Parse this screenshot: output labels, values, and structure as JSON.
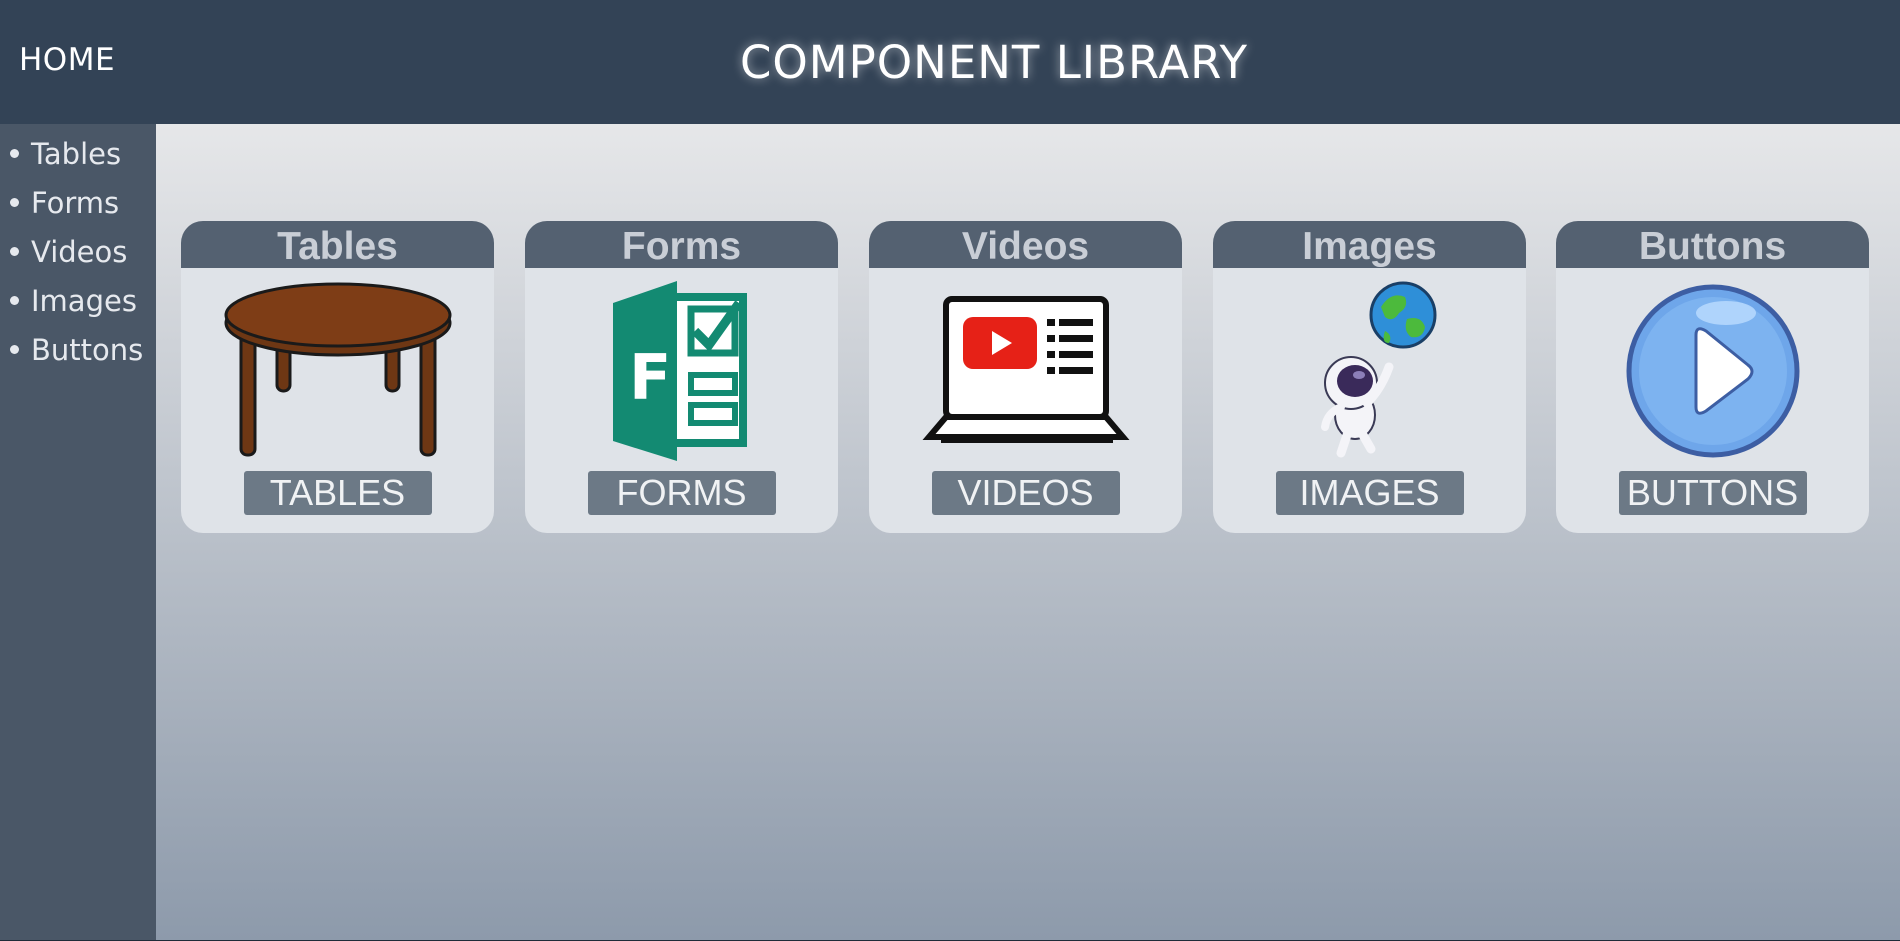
{
  "header": {
    "home_label": "HOME",
    "title": "COMPONENT LIBRARY"
  },
  "sidebar": {
    "items": [
      {
        "label": "Tables"
      },
      {
        "label": "Forms"
      },
      {
        "label": "Videos"
      },
      {
        "label": "Images"
      },
      {
        "label": "Buttons"
      }
    ]
  },
  "cards": [
    {
      "title": "Tables",
      "button_label": "TABLES",
      "icon": "table-icon"
    },
    {
      "title": "Forms",
      "button_label": "FORMS",
      "icon": "forms-icon"
    },
    {
      "title": "Videos",
      "button_label": "VIDEOS",
      "icon": "laptop-video-icon"
    },
    {
      "title": "Images",
      "button_label": "IMAGES",
      "icon": "astronaut-globe-icon"
    },
    {
      "title": "Buttons",
      "button_label": "BUTTONS",
      "icon": "play-button-icon"
    }
  ],
  "colors": {
    "header_bg": "#334356",
    "sidebar_bg": "#4a5767",
    "card_header_bg": "#546171",
    "card_button_bg": "#6c7986",
    "forms_green": "#138a72",
    "youtube_red": "#e62117",
    "play_blue": "#6ea6ea"
  }
}
